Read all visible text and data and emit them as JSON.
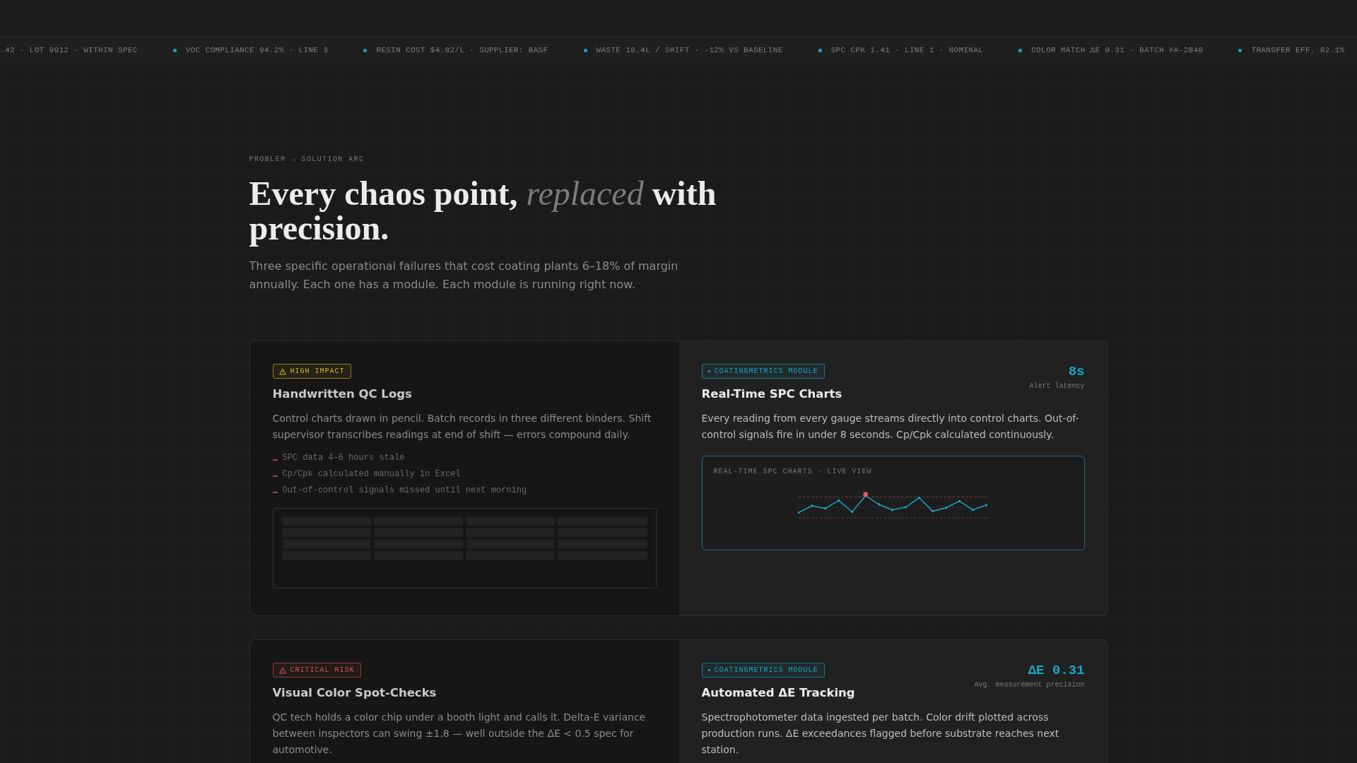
{
  "ticker": [
    {
      "text": ".42 · LOT 9912 · WITHIN SPEC",
      "dot": false
    },
    {
      "text": "VOC COMPLIANCE 94.2% · LINE 3",
      "dot": true
    },
    {
      "text": "RESIN COST $4.82/L · SUPPLIER: BASF",
      "dot": true
    },
    {
      "text": "WASTE 18.4L / SHIFT · -12% VS BASELINE",
      "dot": true
    },
    {
      "text": "SPC CPK 1.41 · LINE 1 · NOMINAL",
      "dot": true
    },
    {
      "text": "COLOR MATCH ΔE 0.31 · BATCH #A-2848",
      "dot": true
    },
    {
      "text": "TRANSFER EFF. 82.1%",
      "dot": true
    }
  ],
  "section": {
    "eyebrow": "PROBLEM → SOLUTION ARC",
    "headline": "Every chaos point, *replaced* with precision.",
    "subtitle": "Three specific operational failures that cost coating plants 6–18% of margin annually. Each one has a module. Each module is running right now."
  },
  "cards": [
    {
      "problem": {
        "badge": {
          "label": "HIGH IMPACT",
          "kind": "warning"
        },
        "title": "Handwritten QC Logs",
        "body": "Control charts drawn in pencil. Batch records in three different binders. Shift supervisor transcribes readings at end of shift — errors compound daily.",
        "bullets": [
          "SPC data 4–6 hours stale",
          "Cp/Cpk calculated manually in Excel",
          "Out-of-control signals missed until next morning"
        ],
        "preview": {
          "kind": "spreadsheet"
        }
      },
      "solution": {
        "badge": "COATINGMETRICS MODULE",
        "title": "Real-Time SPC Charts",
        "body": "Every reading from every gauge streams directly into control charts. Out-of-control signals fire in under 8 seconds. Cp/Cpk calculated continuously.",
        "metric": {
          "value": "8s",
          "label": "Alert latency"
        },
        "preview": {
          "kind": "spc",
          "title": "REAL-TIME SPC CHARTS · LIVE VIEW"
        }
      }
    },
    {
      "problem": {
        "badge": {
          "label": "CRITICAL RISK",
          "kind": "critical"
        },
        "title": "Visual Color Spot-Checks",
        "body": "QC tech holds a color chip under a booth light and calls it. Delta-E variance between inspectors can swing ±1.8 — well outside the ΔE < 0.5 spec for automotive."
      },
      "solution": {
        "badge": "COATINGMETRICS MODULE",
        "title": "Automated ΔE Tracking",
        "body": "Spectrophotometer data ingested per batch. Color drift plotted across production runs. ΔE exceedances flagged before substrate reaches next station.",
        "metric": {
          "value": "ΔE 0.31",
          "label": "Avg. measurement precision"
        }
      }
    }
  ]
}
